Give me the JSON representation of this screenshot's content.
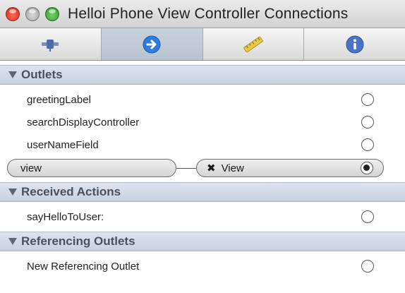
{
  "window": {
    "title": "Helloi Phone View Controller Connections"
  },
  "toolbar": {
    "tabs": [
      {
        "icon": "attributes-icon",
        "active": false
      },
      {
        "icon": "connections-arrow-icon",
        "active": true
      },
      {
        "icon": "ruler-icon",
        "active": false
      },
      {
        "icon": "info-icon",
        "active": false
      }
    ]
  },
  "outlets": {
    "header": "Outlets",
    "items": [
      {
        "name": "greetingLabel",
        "connected": false
      },
      {
        "name": "searchDisplayController",
        "connected": false
      },
      {
        "name": "userNameField",
        "connected": false
      },
      {
        "name": "view",
        "connected": true,
        "target": "View",
        "target_prefix": "✖"
      }
    ]
  },
  "received_actions": {
    "header": "Received Actions",
    "items": [
      {
        "name": "sayHelloToUser:",
        "connected": false
      }
    ]
  },
  "referencing_outlets": {
    "header": "Referencing Outlets",
    "items": [
      {
        "name": "New Referencing Outlet",
        "connected": false
      }
    ]
  },
  "colors": {
    "accent_blue": "#2f7be0",
    "section_bg": "#cfd7e4"
  }
}
